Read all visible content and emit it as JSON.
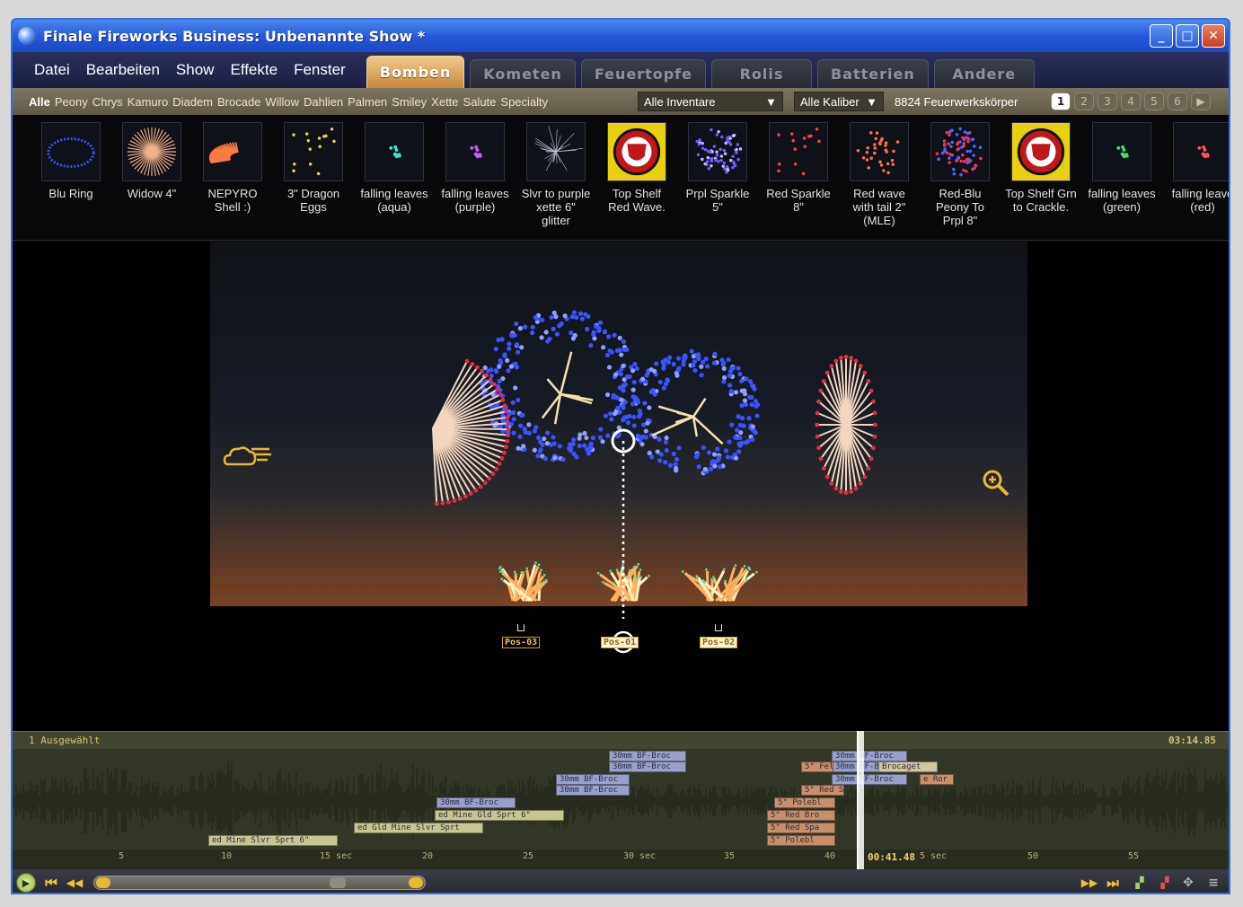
{
  "window": {
    "title": "Finale Fireworks Business: Unbenannte Show *",
    "controls": {
      "minimize": "_",
      "maximize": "□",
      "close": "✕"
    }
  },
  "menu": [
    "Datei",
    "Bearbeiten",
    "Show",
    "Effekte",
    "Fenster"
  ],
  "tabs": [
    {
      "label": "Bomben",
      "active": true
    },
    {
      "label": "Kometen",
      "active": false
    },
    {
      "label": "Feuertopfe",
      "active": false
    },
    {
      "label": "Rolis",
      "active": false
    },
    {
      "label": "Batterien",
      "active": false
    },
    {
      "label": "Andere",
      "active": false
    }
  ],
  "filters": {
    "categories": [
      "Alle",
      "Peony",
      "Chrys",
      "Kamuro",
      "Diadem",
      "Brocade",
      "Willow",
      "Dahlien",
      "Palmen",
      "Smiley",
      "Xette",
      "Salute",
      "Specialty"
    ],
    "inventory": "Alle Inventare",
    "caliber": "Alle Kaliber",
    "count": "8824 Feuerwerkskörper",
    "pages": [
      "1",
      "2",
      "3",
      "4",
      "5",
      "6"
    ],
    "next_icon": "▶"
  },
  "effects": [
    {
      "line1": "Blu Ring",
      "line2": "",
      "line3": "",
      "thumb": "ring",
      "color": "#3a55ff"
    },
    {
      "line1": "Widow 4\"",
      "line2": "",
      "line3": "",
      "thumb": "burst",
      "color": "#f0b08a"
    },
    {
      "line1": "NEPYRO",
      "line2": "Shell :)",
      "line3": "",
      "thumb": "arc",
      "color": "#ff7a40"
    },
    {
      "line1": "3\" Dragon",
      "line2": "Eggs",
      "line3": "",
      "thumb": "dots",
      "color": "#f0d040"
    },
    {
      "line1": "falling leaves",
      "line2": "(aqua)",
      "line3": "",
      "thumb": "small",
      "color": "#40e0d0"
    },
    {
      "line1": "falling leaves",
      "line2": "(purple)",
      "line3": "",
      "thumb": "small",
      "color": "#c060ff"
    },
    {
      "line1": "Slvr to purple",
      "line2": "xette 6\"",
      "line3": "glitter",
      "thumb": "sparks",
      "color": "#c8c8d8"
    },
    {
      "line1": "Top Shelf",
      "line2": "Red Wave.",
      "line3": "",
      "thumb": "logo",
      "color": "#e8d010"
    },
    {
      "line1": "Prpl Sparkle",
      "line2": "5\"",
      "line3": "",
      "thumb": "sphere",
      "color": "#8c5cff"
    },
    {
      "line1": "Red Sparkle",
      "line2": "8\"",
      "line3": "",
      "thumb": "dots",
      "color": "#ff4040"
    },
    {
      "line1": "Red wave",
      "line2": "with tail 2\"",
      "line3": "(MLE)",
      "thumb": "sphere-sparse",
      "color": "#ff7050"
    },
    {
      "line1": "Red-Blu",
      "line2": "Peony To",
      "line3": "Prpl 8\"",
      "thumb": "sphere-mix",
      "color": "#ff3050"
    },
    {
      "line1": "Top Shelf Grn",
      "line2": "to Crackle.",
      "line3": "",
      "thumb": "logo",
      "color": "#e8d010"
    },
    {
      "line1": "falling leaves",
      "line2": "(green)",
      "line3": "",
      "thumb": "small",
      "color": "#40e070"
    },
    {
      "line1": "falling leave",
      "line2": "(red)",
      "line3": "",
      "thumb": "small",
      "color": "#ff5060"
    }
  ],
  "stage": {
    "positions": [
      {
        "label": "Pos-03",
        "selected": false
      },
      {
        "label": "Pos-01",
        "selected": true
      },
      {
        "label": "Pos-02",
        "selected": false
      }
    ],
    "weather_icon": "cloud-wind-icon",
    "zoom_icon": "zoom-icon"
  },
  "timeline": {
    "selection": "1 Ausgewählt",
    "total_time": "03:14.85",
    "playhead_time": "00:41.48",
    "ticks": [
      "5",
      "10",
      "15 sec",
      "20",
      "25",
      "30 sec",
      "35",
      "40",
      "5 sec",
      "50",
      "55"
    ],
    "cues": [
      {
        "label": "30mm BF-Broc",
        "color": "#9aa0cc"
      },
      {
        "label": "30mm BF-Broc",
        "color": "#9aa0cc"
      },
      {
        "label": "30mm BF-Broc",
        "color": "#9aa0cc"
      },
      {
        "label": "30mm BF-Broc",
        "color": "#9aa0cc"
      },
      {
        "label": "30mm BF-Broc",
        "color": "#9aa0cc"
      },
      {
        "label": "ed Mine Gld Sprt 6\"",
        "color": "#c8c690"
      },
      {
        "label": "ed Gld Mine Slvr Sprt",
        "color": "#c8c690"
      },
      {
        "label": "ed Mine Slvr Sprt 6\"",
        "color": "#c8c690"
      },
      {
        "label": "30mm BF-Broc",
        "color": "#9aa0cc"
      },
      {
        "label": "30mm BF-Broc",
        "color": "#9aa0cc"
      },
      {
        "label": "30mm BF-Broc",
        "color": "#9aa0cc"
      },
      {
        "label": "Brocaget",
        "color": "#d0c8a0"
      },
      {
        "label": "5\" Fel",
        "color": "#c8906a"
      },
      {
        "label": "5\" Polebl",
        "color": "#c8906a"
      },
      {
        "label": "5\" Red Bro",
        "color": "#c8906a"
      },
      {
        "label": "5\" Red Spa",
        "color": "#c8906a"
      },
      {
        "label": "5\" Polebl",
        "color": "#c8906a"
      },
      {
        "label": "5\" Red Spk",
        "color": "#c8906a"
      },
      {
        "label": "e Ror",
        "color": "#c8906a"
      }
    ]
  },
  "transport": {
    "play": "▶",
    "first": "⏮",
    "rewind": "◀◀",
    "ffwd": "▶▶",
    "last": "⏭"
  },
  "colors": {
    "accent": "#c7893d",
    "title_blue": "#2457d6",
    "timeline_text": "#d9c27a",
    "sky_top": "#101218",
    "sky_bottom": "#7a4322"
  }
}
